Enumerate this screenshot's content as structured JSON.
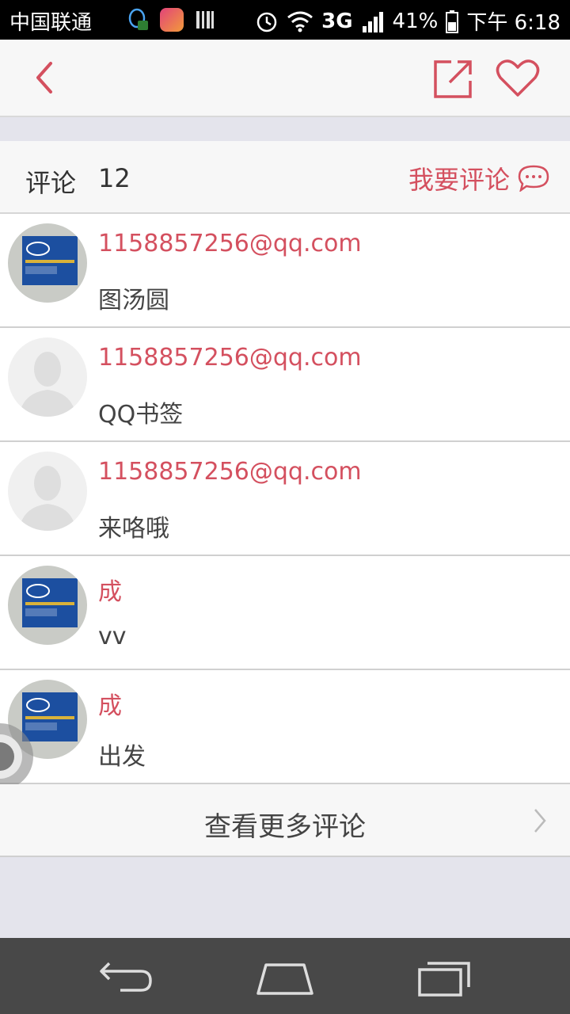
{
  "status_bar": {
    "carrier": "中国联通",
    "network": "3G",
    "battery": "41%",
    "time": "下午 6:18"
  },
  "nav": {
    "back_icon": "chevron-left-icon",
    "share_icon": "share-icon",
    "favorite_icon": "heart-icon"
  },
  "comments_header": {
    "title": "评论",
    "count": "12",
    "write_label": "我要评论"
  },
  "comments": [
    {
      "name": "1158857256@qq.com",
      "text": "图汤圆",
      "avatar": "intel-core-i5-avatar"
    },
    {
      "name": "1158857256@qq.com",
      "text": "QQ书签",
      "avatar": "default-avatar"
    },
    {
      "name": "1158857256@qq.com",
      "text": "来咯哦",
      "avatar": "default-avatar"
    },
    {
      "name": "成",
      "text": "vv",
      "avatar": "intel-core-i5-avatar"
    },
    {
      "name": "成",
      "text": "出发",
      "avatar": "intel-core-i5-avatar"
    }
  ],
  "more_label": "查看更多评论",
  "colors": {
    "accent": "#d4505f",
    "page_bg": "#e4e4ec",
    "nav_bar": "#484848"
  }
}
